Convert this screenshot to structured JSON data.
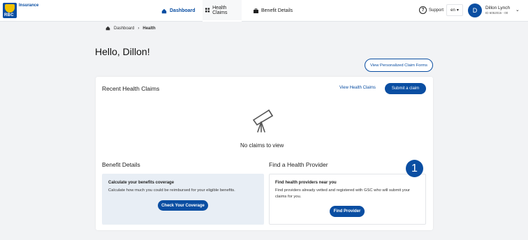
{
  "header": {
    "brand": "Insurance",
    "logo_text": "RBC",
    "nav": [
      {
        "label": "Dashboard",
        "icon": "home-icon"
      },
      {
        "label": "Health Claims",
        "icon": "grid-icon"
      },
      {
        "label": "Benefit Details",
        "icon": "briefcase-icon"
      }
    ],
    "support_label": "Support",
    "language": "en",
    "user": {
      "initial": "D",
      "name": "Dillon Lynch",
      "id": "ID 6052015 - 00"
    }
  },
  "breadcrumb": {
    "home": "Dashboard",
    "current": "Health"
  },
  "greeting": "Hello, Dillon!",
  "claim_forms_button": "View Personalized Claim Forms",
  "recent_claims": {
    "title": "Recent Health Claims",
    "view_link": "View Health Claims",
    "submit_button": "Submit a claim",
    "empty_message": "No claims to view"
  },
  "benefit_details": {
    "title": "Benefit Details",
    "panel_heading": "Calculate your benefits coverage",
    "panel_text": "Calculate how much you could be reimbursed for your eligible benefits.",
    "button": "Check Your Coverage"
  },
  "provider": {
    "title": "Find a Health Provider",
    "panel_heading": "Find health providers near you",
    "panel_text": "Find providers already vetted and registered with GSC who will submit your claims for you.",
    "button": "Find Provider"
  },
  "callout_number": "1",
  "colors": {
    "accent": "#0a4ea2",
    "page_bg": "#f2f3f5",
    "panel_blue": "#e8eef5"
  }
}
